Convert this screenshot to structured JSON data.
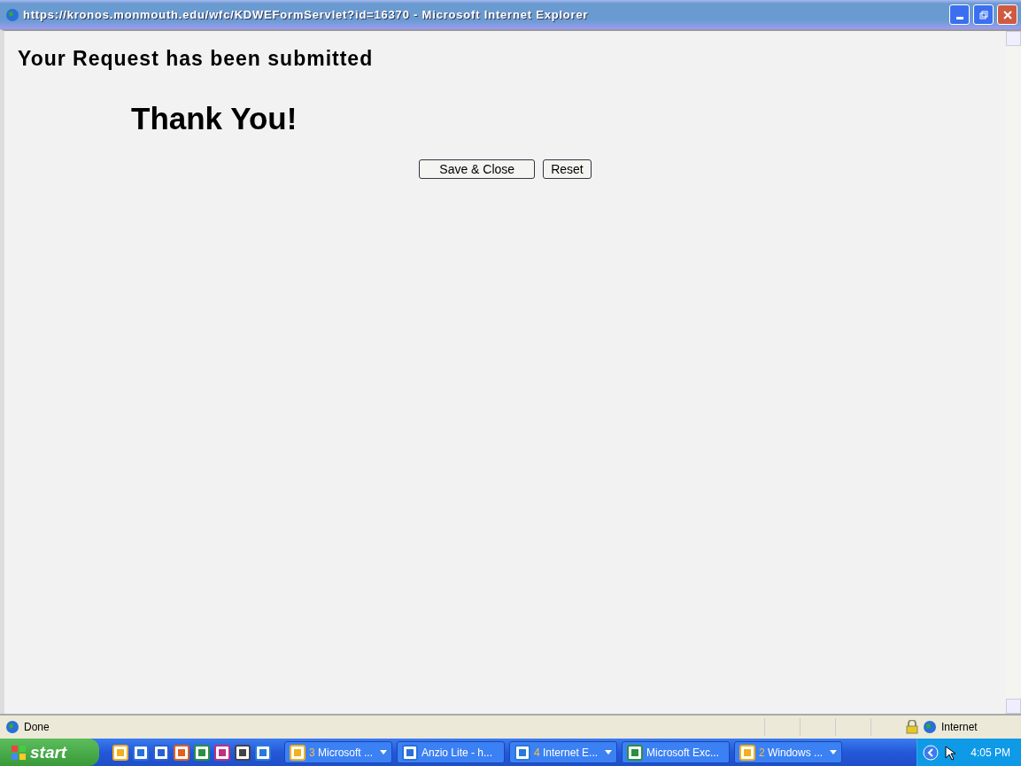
{
  "window": {
    "title": "https://kronos.monmouth.edu/wfc/KDWEFormServlet?id=16370 - Microsoft Internet Explorer"
  },
  "page": {
    "heading": "Your Request has been submitted",
    "message": "Thank You!",
    "buttons": [
      "Save & Close",
      "Reset"
    ]
  },
  "status_bar": {
    "text": "Done",
    "zone": "Internet"
  },
  "taskbar": {
    "start": "start",
    "buttons": [
      {
        "count": "3",
        "label": "Microsoft ...",
        "grouped": true
      },
      {
        "label": "Anzio Lite - h...",
        "grouped": false
      },
      {
        "count": "4",
        "label": "Internet E...",
        "grouped": true
      },
      {
        "label": "Microsoft Exc...",
        "grouped": false
      },
      {
        "count": "2",
        "label": "Windows ...",
        "grouped": true
      }
    ],
    "clock": "4:05 PM"
  }
}
